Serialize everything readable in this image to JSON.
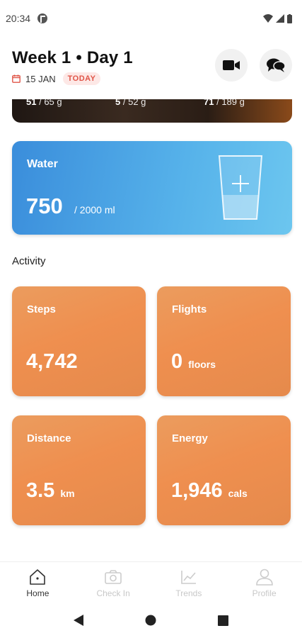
{
  "status_bar": {
    "time": "20:34"
  },
  "header": {
    "title": "Week 1 • Day 1",
    "date": "15 JAN",
    "today_badge": "TODAY",
    "buttons": [
      {
        "icon": "video-camera-icon"
      },
      {
        "icon": "chat-bubbles-icon"
      }
    ]
  },
  "macros": [
    {
      "current": "51",
      "goal": "/ 65 g"
    },
    {
      "current": "5",
      "goal": "/ 52 g"
    },
    {
      "current": "71",
      "goal": "/ 189 g"
    }
  ],
  "water": {
    "label": "Water",
    "value": "750",
    "goal": "/ 2000 ml",
    "fill_fraction": 0.375,
    "icon": "water-glass-plus-icon",
    "color": "#4aa3e4"
  },
  "activity": {
    "title": "Activity",
    "tiles": [
      {
        "label": "Steps",
        "value": "4,742",
        "unit": ""
      },
      {
        "label": "Flights",
        "value": "0",
        "unit": "floors"
      },
      {
        "label": "Distance",
        "value": "3.5",
        "unit": "km"
      },
      {
        "label": "Energy",
        "value": "1,946",
        "unit": "cals"
      }
    ],
    "color": "#ee9050"
  },
  "bottom_nav": [
    {
      "label": "Home",
      "icon": "home-icon",
      "active": true
    },
    {
      "label": "Check In",
      "icon": "camera-icon",
      "active": false
    },
    {
      "label": "Trends",
      "icon": "trend-chart-icon",
      "active": false
    },
    {
      "label": "Profile",
      "icon": "profile-icon",
      "active": false
    }
  ]
}
